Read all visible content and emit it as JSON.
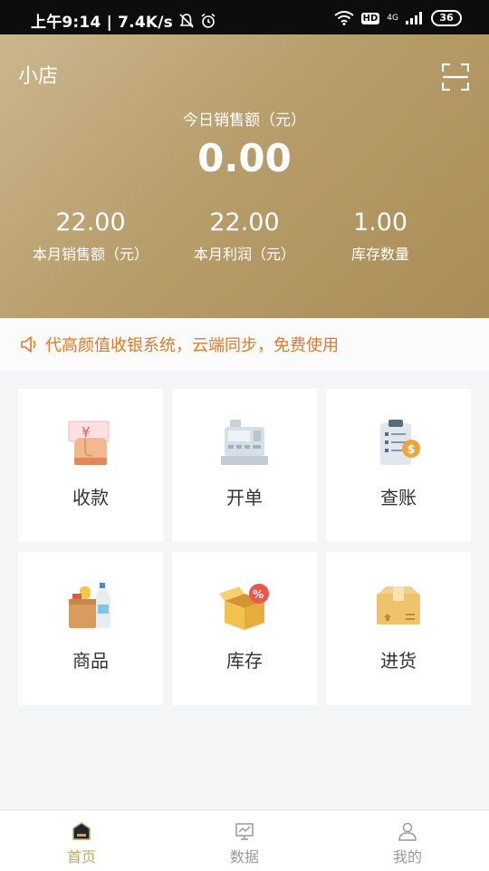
{
  "status_bar": {
    "time_speed": "上午9:14 | 7.4K/s",
    "hd": "HD",
    "network": "4G",
    "battery": "36"
  },
  "header": {
    "shop_name": "小店",
    "today_label": "今日销售额（元）",
    "today_value": "0.00",
    "stats": [
      {
        "value": "22.00",
        "label": "本月销售额（元）"
      },
      {
        "value": "22.00",
        "label": "本月利润（元）"
      },
      {
        "value": "1.00",
        "label": "库存数量"
      }
    ]
  },
  "notice": {
    "text": "代高颜值收银系统，云端同步，免费使用",
    "color": "#dd7a26"
  },
  "grid": [
    {
      "label": "收款",
      "icon": "payment-hand-icon"
    },
    {
      "label": "开单",
      "icon": "cash-register-icon"
    },
    {
      "label": "查账",
      "icon": "clipboard-ledger-icon"
    },
    {
      "label": "商品",
      "icon": "groceries-icon"
    },
    {
      "label": "库存",
      "icon": "open-box-discount-icon"
    },
    {
      "label": "进货",
      "icon": "closed-box-icon"
    }
  ],
  "tabbar": {
    "active_color": "#c7a566",
    "inactive_color": "#999999",
    "tabs": [
      {
        "label": "首页",
        "icon": "home-icon",
        "active": true
      },
      {
        "label": "数据",
        "icon": "chart-icon",
        "active": false
      },
      {
        "label": "我的",
        "icon": "user-icon",
        "active": false
      }
    ]
  }
}
